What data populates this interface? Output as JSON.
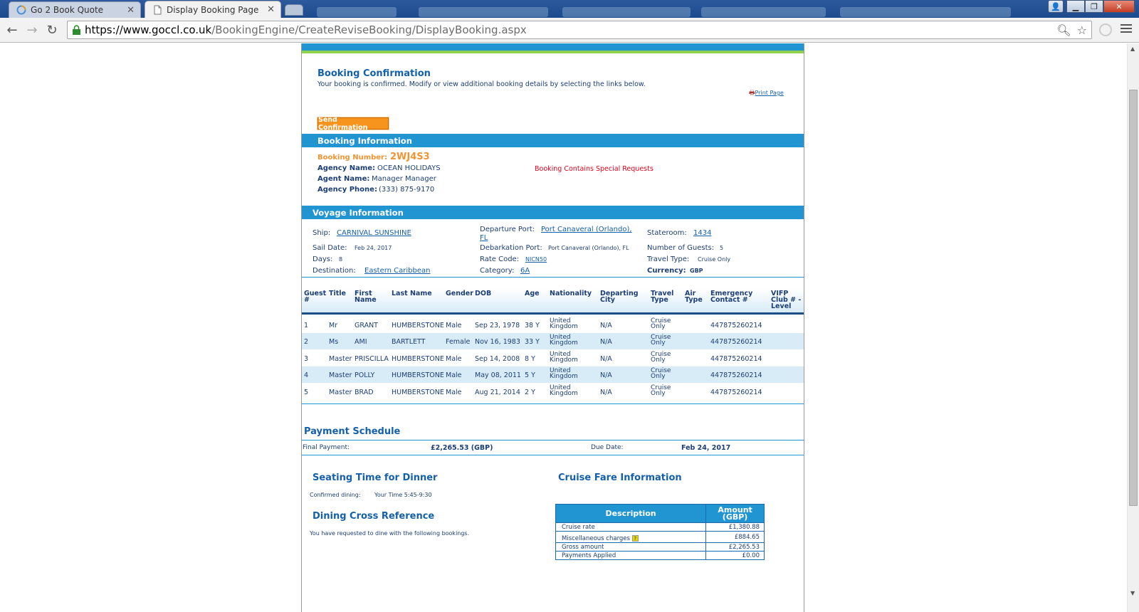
{
  "browser": {
    "tabs": [
      {
        "title": "Go 2 Book Quote",
        "active": false
      },
      {
        "title": "Display Booking Page",
        "active": true
      }
    ],
    "url_host": "https://www.goccl.co.uk",
    "url_path": "/BookingEngine/CreateReviseBooking/DisplayBooking.aspx"
  },
  "confirmation": {
    "title": "Booking Confirmation",
    "message": "Your booking is confirmed. Modify or view additional booking details by selecting the links below.",
    "print_label": "Print Page",
    "send_button": "Send Confirmation"
  },
  "booking_info": {
    "header": "Booking Information",
    "number_label": "Booking Number:",
    "number": "2WJ4S3",
    "agency_label": "Agency Name:",
    "agency": "OCEAN HOLIDAYS",
    "agent_label": "Agent Name:",
    "agent": "Manager Manager",
    "phone_label": "Agency Phone:",
    "phone": "(333) 875-9170",
    "special_requests": "Booking Contains Special Requests"
  },
  "voyage": {
    "header": "Voyage Information",
    "ship_label": "Ship:",
    "ship": "CARNIVAL SUNSHINE",
    "sail_label": "Sail Date:",
    "sail": "Feb 24, 2017",
    "days_label": "Days:",
    "days": "8",
    "dest_label": "Destination:",
    "dest": "Eastern Caribbean",
    "dep_label": "Departure Port:",
    "dep_line1": "Port Canaveral (Orlando),",
    "dep_line2": "FL",
    "deb_label": "Debarkation Port:",
    "deb": "Port Canaveral (Orlando), FL",
    "rate_label": "Rate Code:",
    "rate": "NICN50",
    "cat_label": "Category:",
    "cat": "6A",
    "room_label": "Stateroom:",
    "room": "1434",
    "guests_label": "Number of Guests:",
    "guests": "5",
    "travel_label": "Travel Type:",
    "travel": "Cruise Only",
    "currency_label": "Currency:",
    "currency": "GBP"
  },
  "guest_table": {
    "headers": {
      "guest1": "Guest",
      "guest2": "#",
      "title": "Title",
      "first1": "First",
      "first2": "Name",
      "last": "Last Name",
      "gender": "Gender",
      "dob": "DOB",
      "age": "Age",
      "nationality": "Nationality",
      "dep1": "Departing",
      "dep2": "City",
      "travel1": "Travel",
      "travel2": "Type",
      "air1": "Air",
      "air2": "Type",
      "emerg1": "Emergency",
      "emerg2": "Contact #",
      "vifp1": "VIFP",
      "vifp2": "Club # -",
      "vifp3": "Level"
    },
    "rows": [
      {
        "num": "1",
        "title": "Mr",
        "first": "GRANT",
        "last": "HUMBERSTONE",
        "gender": "Male",
        "dob": "Sep 23, 1978",
        "age": "38 Y",
        "nat1": "United",
        "nat2": "Kingdom",
        "city": "N/A",
        "tt1": "Cruise",
        "tt2": "Only",
        "contact": "447875260214"
      },
      {
        "num": "2",
        "title": "Ms",
        "first": "AMI",
        "last": "BARTLETT",
        "gender": "Female",
        "dob": "Nov 16, 1983",
        "age": "33 Y",
        "nat1": "United",
        "nat2": "Kingdom",
        "city": "N/A",
        "tt1": "Cruise",
        "tt2": "Only",
        "contact": "447875260214"
      },
      {
        "num": "3",
        "title": "Master",
        "first": "PRISCILLA",
        "last": "HUMBERSTONE",
        "gender": "Male",
        "dob": "Sep 14, 2008",
        "age": "8 Y",
        "nat1": "United",
        "nat2": "Kingdom",
        "city": "N/A",
        "tt1": "Cruise",
        "tt2": "Only",
        "contact": "447875260214"
      },
      {
        "num": "4",
        "title": "Master",
        "first": "POLLY",
        "last": "HUMBERSTONE",
        "gender": "Male",
        "dob": "May 08, 2011",
        "age": "5 Y",
        "nat1": "United",
        "nat2": "Kingdom",
        "city": "N/A",
        "tt1": "Cruise",
        "tt2": "Only",
        "contact": "447875260214"
      },
      {
        "num": "5",
        "title": "Master",
        "first": "BRAD",
        "last": "HUMBERSTONE",
        "gender": "Male",
        "dob": "Aug 21, 2014",
        "age": "2 Y",
        "nat1": "United",
        "nat2": "Kingdom",
        "city": "N/A",
        "tt1": "Cruise",
        "tt2": "Only",
        "contact": "447875260214"
      }
    ]
  },
  "payment": {
    "title": "Payment Schedule",
    "final_label": "Final Payment:",
    "final_amount": "£2,265.53 (GBP)",
    "due_label": "Due Date:",
    "due_date": "Feb 24, 2017"
  },
  "dining": {
    "seating_title": "Seating Time for Dinner",
    "confirmed_label": "Confirmed dining:",
    "confirmed_value": "Your Time 5:45-9:30",
    "cross_title": "Dining Cross Reference",
    "cross_text": "You have requested to dine with the following bookings."
  },
  "fare": {
    "title": "Cruise Fare Information",
    "col_desc": "Description",
    "col_amount1": "Amount",
    "col_amount2": "(GBP)",
    "rows": [
      {
        "desc": "Cruise rate",
        "amount": "£1,380.88"
      },
      {
        "desc": "Miscellaneous charges",
        "amount": "£884.65"
      },
      {
        "desc": "Gross amount",
        "amount": "£2,265.53"
      },
      {
        "desc": "Payments Applied",
        "amount": "£0.00"
      }
    ]
  }
}
